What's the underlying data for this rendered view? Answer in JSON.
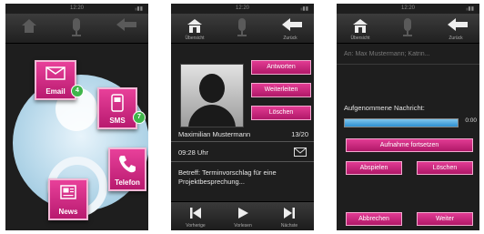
{
  "status": {
    "time": "12:20",
    "signal": "ᵢᵢ▮▮"
  },
  "phone1": {
    "tiles": [
      {
        "label": "Email",
        "badge": "4"
      },
      {
        "label": "SMS",
        "badge": "7"
      },
      {
        "label": "Telefon"
      },
      {
        "label": "News"
      }
    ]
  },
  "phone2": {
    "topbar": {
      "left_label": "Übersicht",
      "right_label": "Zurück"
    },
    "actions": [
      "Antworten",
      "Weiterleiten",
      "Löschen"
    ],
    "sender": "Maximilian Mustermann",
    "counter": "13/20",
    "time": "09:28 Uhr",
    "subject": "Betreff: Terminvorschlag für eine Projektbesprechung...",
    "bottombar": {
      "prev": "Vorherige",
      "play": "Vorlesen",
      "next": "Nächste"
    }
  },
  "phone3": {
    "topbar": {
      "left_label": "Übersicht",
      "right_label": "Zurück"
    },
    "recipient": "An: Max Mustermann; Katrin...",
    "recorded_label": "Aufgenommene Nachricht:",
    "progress_time": "0:00",
    "progress_fraction": 1.0,
    "buttons": {
      "continue": "Aufnahme fortsetzen",
      "play": "Abspielen",
      "delete": "Löschen",
      "cancel": "Abbrechen",
      "next": "Weiter"
    }
  },
  "colors": {
    "accent": "#d42d84",
    "progress": "#3c9ad9"
  }
}
